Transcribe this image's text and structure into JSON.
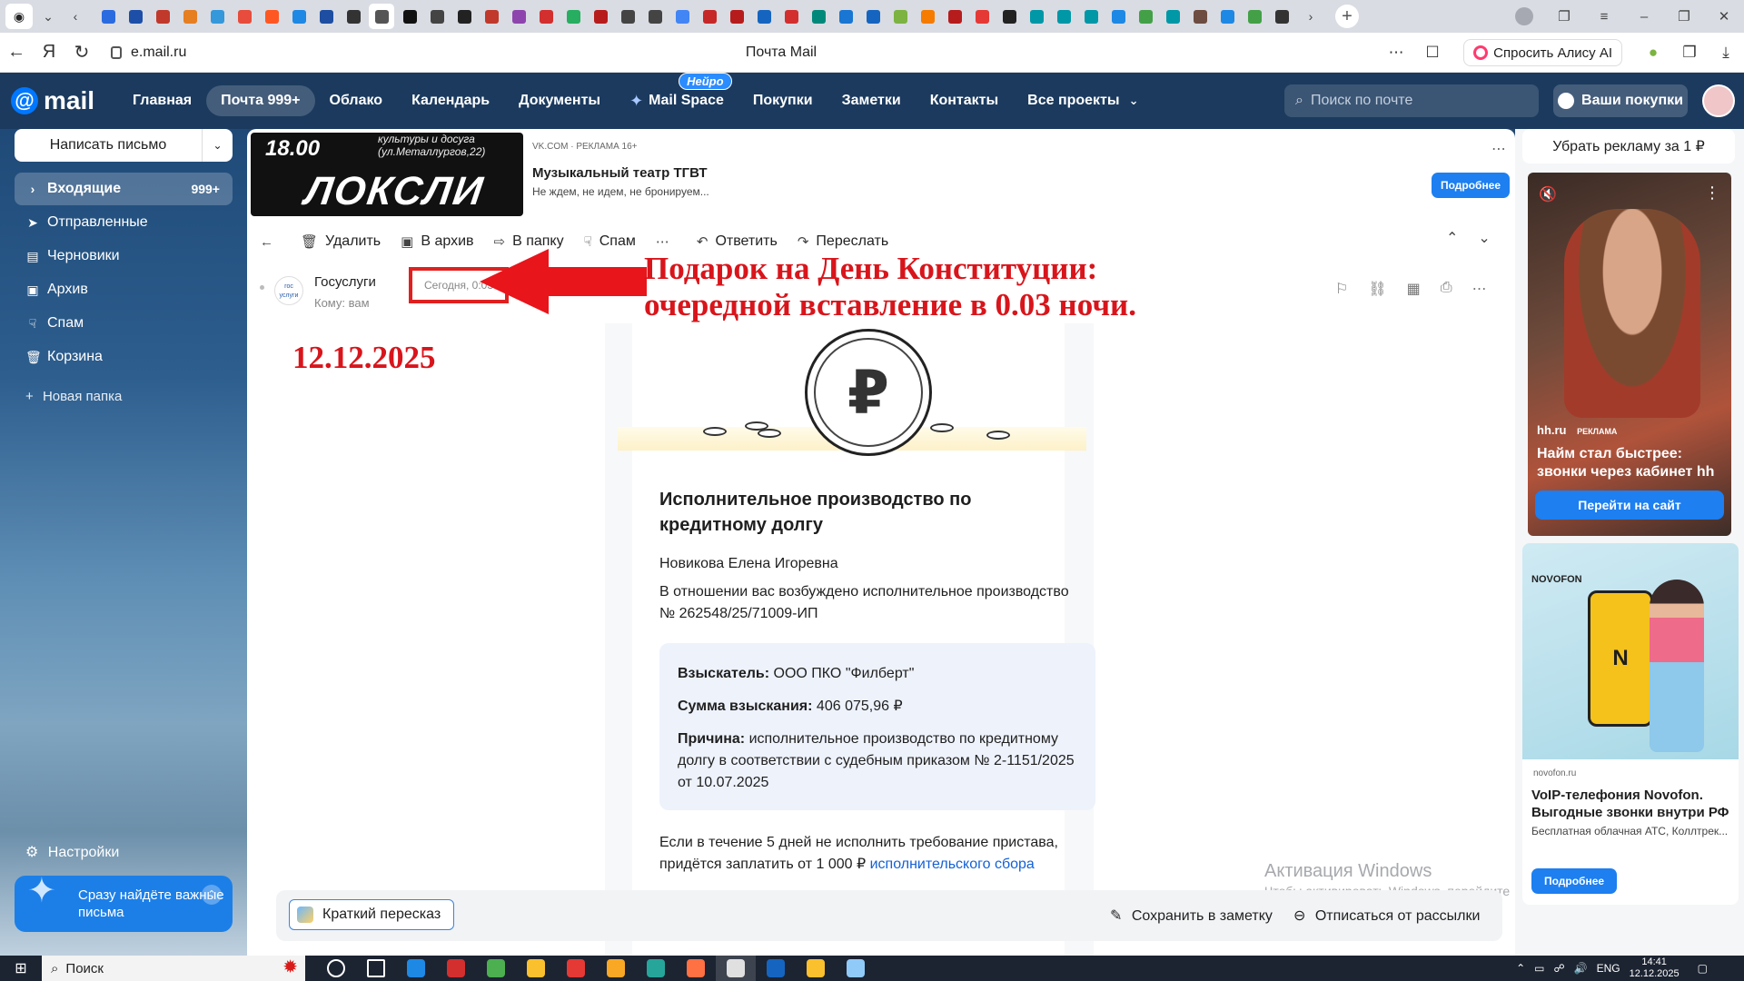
{
  "browser": {
    "tab_colors": [
      "#2b6be0",
      "#1d4fa8",
      "#c0392b",
      "#e67e22",
      "#3498db",
      "#e74c3c",
      "#ff5722",
      "#1e88e5",
      "#1e4ea1",
      "#333333",
      "#555555",
      "#111111",
      "#444444",
      "#222222",
      "#c0392b",
      "#8e44ad",
      "#d32f2f",
      "#27ae60",
      "#b71c1c",
      "#444444",
      "#444444",
      "#4285f4",
      "#c62828",
      "#b71c1c",
      "#1565c0",
      "#d32f2f",
      "#00897b",
      "#1976d2",
      "#1565c0",
      "#7cb342",
      "#f57c00",
      "#b71c1c",
      "#e53935",
      "#222222",
      "#0097a7",
      "#0097a7",
      "#0097a7",
      "#1e88e5",
      "#43a047",
      "#0097a7",
      "#6d4c41",
      "#1e88e5",
      "#43a047",
      "#333333"
    ],
    "url": "e.mail.ru",
    "page_title": "Почта Mail",
    "alice_label": "Спросить Алису AI"
  },
  "mail": {
    "logo_text": "mail",
    "nav": [
      "Главная",
      "Почта 999+",
      "Облако",
      "Календарь",
      "Документы",
      "Mail Space",
      "Покупки",
      "Заметки",
      "Контакты",
      "Все проекты"
    ],
    "neuro_badge": "Нейро",
    "search_placeholder": "Поиск по почте",
    "purchases": "Ваши покупки"
  },
  "sidebar": {
    "compose": "Написать письмо",
    "folders": [
      {
        "label": "Входящие",
        "count": "999+"
      },
      {
        "label": "Отправленные"
      },
      {
        "label": "Черновики"
      },
      {
        "label": "Архив"
      },
      {
        "label": "Спам"
      },
      {
        "label": "Корзина"
      }
    ],
    "new_folder": "Новая папка",
    "settings": "Настройки",
    "promo": "Сразу найдёте важные письма"
  },
  "ad": {
    "img_time": "18.00",
    "img_sub": "культуры и досуга (ул.Металлургов,22)",
    "img_title": "ЛОКСЛИ",
    "meta": "VK.COM · РЕКЛАМА 16+",
    "title": "Музыкальный театр ТГВТ",
    "subtitle": "Не ждем, не идем, не бронируем...",
    "button": "Подробнее"
  },
  "toolbar": {
    "delete": "Удалить",
    "archive": "В архив",
    "move": "В папку",
    "spam": "Спам",
    "reply": "Ответить",
    "forward": "Переслать"
  },
  "message": {
    "sender": "Госуслуги",
    "avatar_text": "гос услуги",
    "to": "Кому: вам",
    "date": "Сегодня, 0:03"
  },
  "annotation": {
    "line1": "Подарок на День Конституции:",
    "line2": "очередной вставление в 0.03 ночи.",
    "date": "12.12.2025"
  },
  "letter": {
    "title": "Исполнительное производство по кредитному долгу",
    "name": "Новикова Елена Игоревна",
    "text": "В отношении вас возбуждено исполнительное производство № 262548/25/71009-ИП",
    "claimant_label": "Взыскатель:",
    "claimant": "ООО ПКО \"Филберт\"",
    "amount_label": "Сумма взыскания:",
    "amount": "406 075,96 ₽",
    "reason_label": "Причина:",
    "reason": "исполнительное производство по кредитному долгу в соответствии с судебным приказом № 2-1151/2025 от 10.07.2025",
    "footer_text": "Если в течение 5 дней не исполнить требование пристава, придётся заплатить от 1 000 ₽",
    "footer_link": "исполнительского сбора"
  },
  "bottom": {
    "summary": "Краткий пересказ",
    "save_note": "Сохранить в заметку",
    "unsubscribe": "Отписаться от рассылки"
  },
  "watermark": {
    "title": "Активация Windows",
    "sub": "Чтобы активировать Windows, перейдите в раздел \"Параметры\"."
  },
  "right": {
    "remove_ads": "Убрать рекламу за 1 ₽",
    "hh_brand": "hh.ru",
    "hh_adlabel": "РЕКЛАМА",
    "hh_title": "Найм стал быстрее: звонки через кабинет hh",
    "hh_button": "Перейти на сайт",
    "novo_logo": "NOVOFON",
    "novo_site": "novofon.ru",
    "novo_title": "VoIP-телефония Novofon. Выгодные звонки внутри РФ",
    "novo_sub": "Бесплатная облачная АТС, Коллтрек...",
    "novo_button": "Подробнее"
  },
  "taskbar": {
    "search": "Поиск",
    "app_colors": [
      "#ffffff",
      "#ffffff",
      "#1e88e5",
      "#d32f2f",
      "#4caf50",
      "#fbc02d",
      "#e53935",
      "#f9a825",
      "#26a69a",
      "#ff7043",
      "#e0e0e0",
      "#1565c0",
      "#fbc02d",
      "#90caf9"
    ],
    "lang": "ENG",
    "time": "14:41",
    "date": "12.12.2025"
  }
}
